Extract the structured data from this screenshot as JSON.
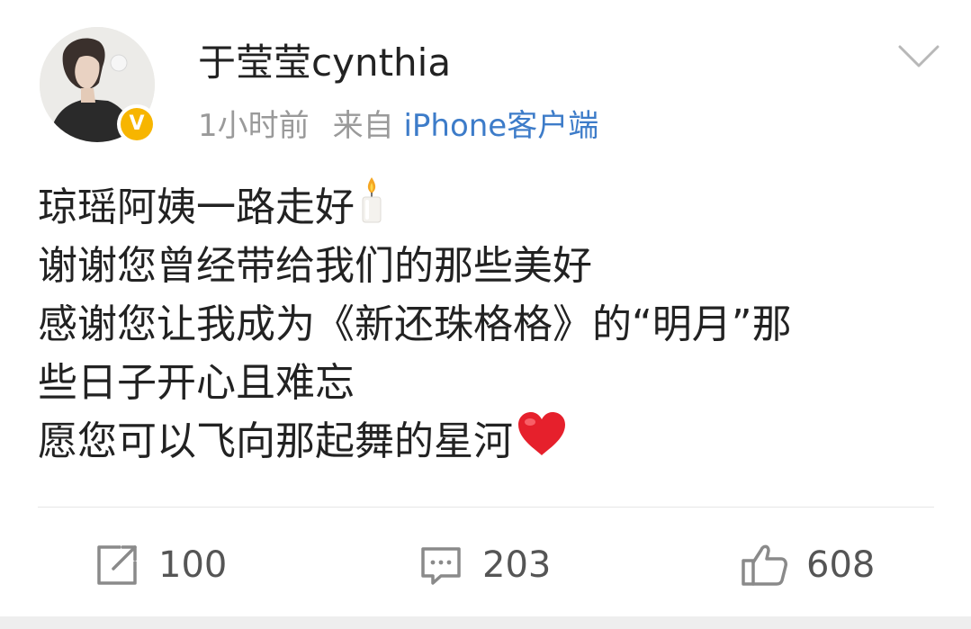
{
  "post": {
    "author": {
      "name": "于莹莹cynthia",
      "verified_badge": "V",
      "verified_color": "#f7b500"
    },
    "meta": {
      "time": "1小时前",
      "source_prefix": "来自",
      "source": "iPhone客户端",
      "source_color": "#3d7cc9"
    },
    "menu_icon": "chevron-down-icon",
    "content": {
      "lines": [
        "琼瑶阿姨一路走好",
        "谢谢您曾经带给我们的那些美好",
        "感谢您让我成为《新还珠格格》的“明月”那",
        "些日子开心且难忘",
        "愿您可以飞向那起舞的星河"
      ],
      "emojis": [
        "candle-emoji",
        "red-heart-emoji"
      ]
    },
    "actions": {
      "repost": {
        "icon": "repost-icon",
        "count": "100"
      },
      "comment": {
        "icon": "comment-icon",
        "count": "203"
      },
      "like": {
        "icon": "thumbs-up-icon",
        "count": "608"
      }
    }
  }
}
